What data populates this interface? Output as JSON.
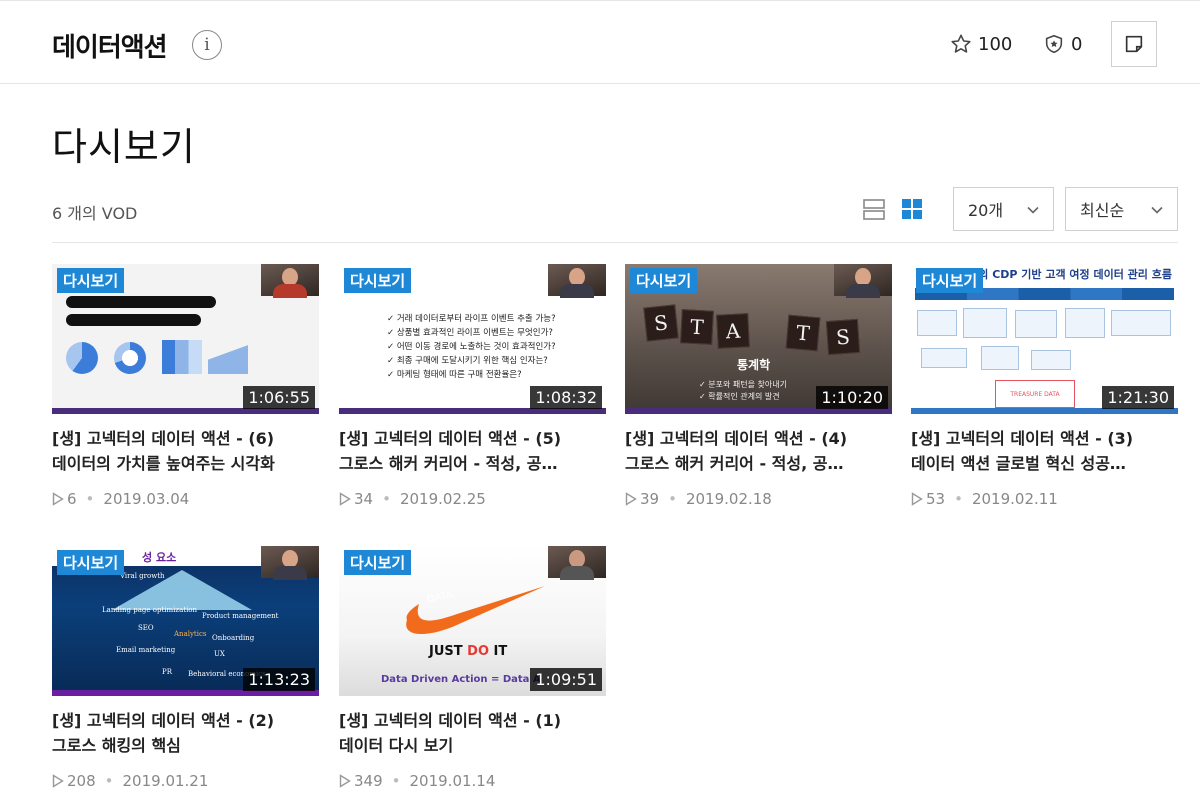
{
  "header": {
    "channel_name": "데이터액션",
    "info_label": "i",
    "star_count": "100",
    "badge_count": "0"
  },
  "page": {
    "title": "다시보기",
    "vod_count": "6 개의 VOD",
    "per_page": "20개",
    "sort": "최신순"
  },
  "colors": {
    "accent": "#1e88d6",
    "badge_bg": "#1e88d6",
    "duration_bg": "#000000"
  },
  "videos": [
    {
      "badge": "다시보기",
      "duration": "1:06:55",
      "title_line1": "[생] 고넥터의 데이터 액션 - (6)",
      "title_line2": "데이터의 가치를 높여주는 시각화",
      "views": "6",
      "date": "2019.03.04"
    },
    {
      "badge": "다시보기",
      "duration": "1:08:32",
      "title_line1": "[생] 고넥터의 데이터 액션 - (5)",
      "title_line2": "그로스 해커 커리어 - 적성, 공…",
      "views": "34",
      "date": "2019.02.25"
    },
    {
      "badge": "다시보기",
      "duration": "1:10:20",
      "title_line1": "[생] 고넥터의 데이터 액션 - (4)",
      "title_line2": "그로스 해커 커리어 - 적성, 공…",
      "views": "39",
      "date": "2019.02.18"
    },
    {
      "badge": "다시보기",
      "duration": "1:21:30",
      "title_line1": "[생] 고넥터의 데이터 액션 - (3)",
      "title_line2": "데이터 액션 글로벌 혁신 성공…",
      "views": "53",
      "date": "2019.02.11"
    },
    {
      "badge": "다시보기",
      "duration": "1:13:23",
      "title_line1": "[생] 고넥터의 데이터 액션 - (2)",
      "title_line2": "그로스 해킹의 핵심",
      "views": "208",
      "date": "2019.01.21"
    },
    {
      "badge": "다시보기",
      "duration": "1:09:51",
      "title_line1": "[생] 고넥터의 데이터 액션 - (1)",
      "title_line2": "데이터 다시 보기",
      "views": "349",
      "date": "2019.01.14"
    }
  ],
  "thumb_text": {
    "t2_lines": [
      "✓ 거래 데이터로부터 라이프 이벤트 추출 가능?",
      "✓ 상품별 효과적인 라이프 이벤트는 무엇인가?",
      "✓ 어떤 이동 경로에 노출하는 것이 효과적인가?",
      "✓ 최종 구매에 도달시키기 위한 핵심 인자는?",
      "✓ 마케팅 형태에 따른 구매 전환율은?"
    ],
    "t3_letters": [
      "S",
      "T",
      "A",
      "T",
      "S"
    ],
    "t3_caption": "통계학",
    "t3_bullets": [
      "✓ 분포와 패턴을 찾아내기",
      "✓ 확률적인 관계의 발견"
    ],
    "t4_heading": "VOM의 CDP 기반 고객 여정 데이터 관리 흐름",
    "t4_logo": "TREASURE DATA",
    "t5_heading": "성 요소",
    "t5_words": [
      "Viral growth",
      "Landing page optimization",
      "Product management",
      "SEO",
      "Analytics",
      "Onboarding",
      "UX",
      "Email marketing",
      "PR",
      "Behavioral economics"
    ],
    "t6_data": "DATA",
    "t6_just": "JUST ",
    "t6_do": "DO",
    "t6_it": " IT",
    "t6_footer": "Data Driven Action = Data A"
  }
}
